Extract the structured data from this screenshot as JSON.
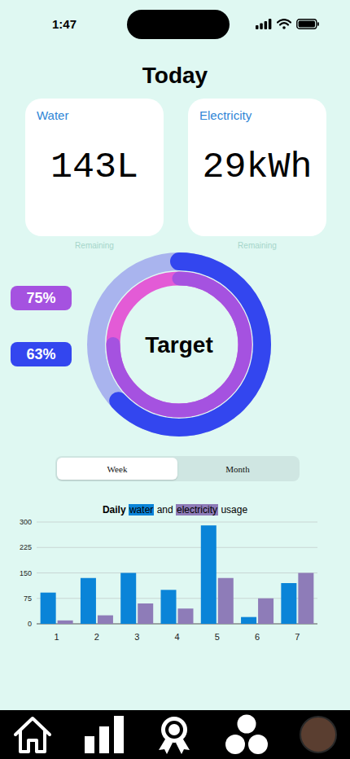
{
  "status_bar": {
    "time": "1:47"
  },
  "title": "Today",
  "cards": [
    {
      "label": "Water",
      "value": "143L",
      "note": "Remaining"
    },
    {
      "label": "Electricity",
      "value": "29kWh",
      "note": "Remaining"
    }
  ],
  "target": {
    "label": "Target",
    "rings": [
      {
        "reading": "75%",
        "level": 0.75,
        "color": "#a552e0"
      },
      {
        "reading": "63%",
        "level": 0.63,
        "color": "#3346ef"
      }
    ]
  },
  "range_tabs": [
    {
      "label": "Week",
      "selected": true
    },
    {
      "label": "Month",
      "selected": false
    }
  ],
  "chart": {
    "title": {
      "before": "Daily",
      "between": "and",
      "after": "usage"
    },
    "series": [
      {
        "name": "water",
        "color": "#0a84d8",
        "values": [
          92,
          135,
          150,
          100,
          290,
          20,
          120
        ]
      },
      {
        "name": "electricity",
        "color": "#8e7cb8",
        "values": [
          10,
          25,
          60,
          45,
          135,
          75,
          150
        ]
      }
    ],
    "y_ticks": [
      "0",
      "75",
      "150",
      "225",
      "300"
    ],
    "x_labels": [
      "1",
      "2",
      "3",
      "4",
      "5",
      "6",
      "7"
    ]
  }
}
